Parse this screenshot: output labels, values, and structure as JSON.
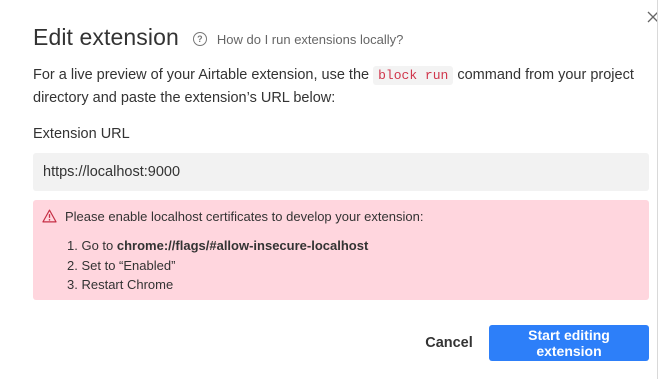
{
  "dialog": {
    "title": "Edit extension",
    "help_icon": "question-circle-icon",
    "help_text": "How do I run extensions locally?",
    "close_icon": "close-icon",
    "description": {
      "before": "For a live preview of your Airtable extension, use the ",
      "code": "block run",
      "after": " command from your project directory and paste the extension’s URL below:"
    },
    "url_field": {
      "label": "Extension URL",
      "value": "https://localhost:9000"
    },
    "alert": {
      "icon": "warning-icon",
      "title": "Please enable localhost certificates to develop your extension:",
      "steps": [
        {
          "number": "1.",
          "prefix": "Go to ",
          "bold": "chrome://flags/#allow-insecure-localhost"
        },
        {
          "number": "2.",
          "prefix": "Set to “Enabled”",
          "bold": ""
        },
        {
          "number": "3.",
          "prefix": "Restart Chrome",
          "bold": ""
        }
      ]
    },
    "buttons": {
      "cancel": "Cancel",
      "primary": "Start editing extension"
    }
  },
  "colors": {
    "primary": "#2d7ff9",
    "alert_background": "#ffd6de",
    "code_text": "#d0364c"
  }
}
